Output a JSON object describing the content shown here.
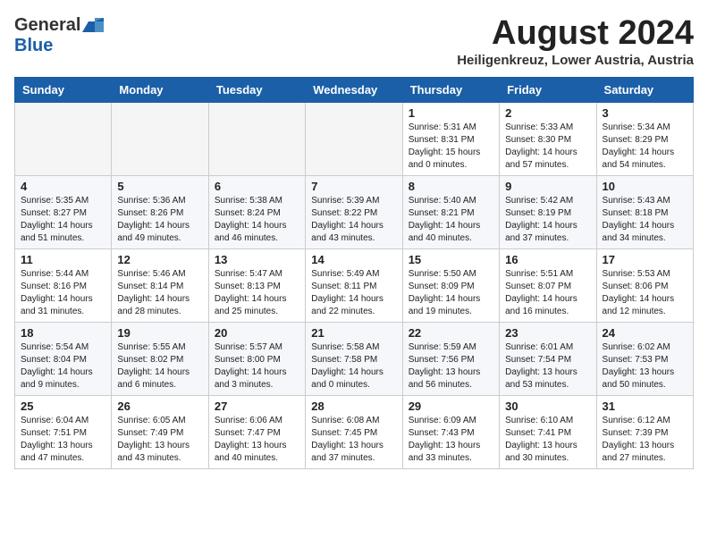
{
  "header": {
    "logo_general": "General",
    "logo_blue": "Blue",
    "month_title": "August 2024",
    "location": "Heiligenkreuz, Lower Austria, Austria"
  },
  "weekdays": [
    "Sunday",
    "Monday",
    "Tuesday",
    "Wednesday",
    "Thursday",
    "Friday",
    "Saturday"
  ],
  "weeks": [
    [
      {
        "day": "",
        "info": ""
      },
      {
        "day": "",
        "info": ""
      },
      {
        "day": "",
        "info": ""
      },
      {
        "day": "",
        "info": ""
      },
      {
        "day": "1",
        "info": "Sunrise: 5:31 AM\nSunset: 8:31 PM\nDaylight: 15 hours\nand 0 minutes."
      },
      {
        "day": "2",
        "info": "Sunrise: 5:33 AM\nSunset: 8:30 PM\nDaylight: 14 hours\nand 57 minutes."
      },
      {
        "day": "3",
        "info": "Sunrise: 5:34 AM\nSunset: 8:29 PM\nDaylight: 14 hours\nand 54 minutes."
      }
    ],
    [
      {
        "day": "4",
        "info": "Sunrise: 5:35 AM\nSunset: 8:27 PM\nDaylight: 14 hours\nand 51 minutes."
      },
      {
        "day": "5",
        "info": "Sunrise: 5:36 AM\nSunset: 8:26 PM\nDaylight: 14 hours\nand 49 minutes."
      },
      {
        "day": "6",
        "info": "Sunrise: 5:38 AM\nSunset: 8:24 PM\nDaylight: 14 hours\nand 46 minutes."
      },
      {
        "day": "7",
        "info": "Sunrise: 5:39 AM\nSunset: 8:22 PM\nDaylight: 14 hours\nand 43 minutes."
      },
      {
        "day": "8",
        "info": "Sunrise: 5:40 AM\nSunset: 8:21 PM\nDaylight: 14 hours\nand 40 minutes."
      },
      {
        "day": "9",
        "info": "Sunrise: 5:42 AM\nSunset: 8:19 PM\nDaylight: 14 hours\nand 37 minutes."
      },
      {
        "day": "10",
        "info": "Sunrise: 5:43 AM\nSunset: 8:18 PM\nDaylight: 14 hours\nand 34 minutes."
      }
    ],
    [
      {
        "day": "11",
        "info": "Sunrise: 5:44 AM\nSunset: 8:16 PM\nDaylight: 14 hours\nand 31 minutes."
      },
      {
        "day": "12",
        "info": "Sunrise: 5:46 AM\nSunset: 8:14 PM\nDaylight: 14 hours\nand 28 minutes."
      },
      {
        "day": "13",
        "info": "Sunrise: 5:47 AM\nSunset: 8:13 PM\nDaylight: 14 hours\nand 25 minutes."
      },
      {
        "day": "14",
        "info": "Sunrise: 5:49 AM\nSunset: 8:11 PM\nDaylight: 14 hours\nand 22 minutes."
      },
      {
        "day": "15",
        "info": "Sunrise: 5:50 AM\nSunset: 8:09 PM\nDaylight: 14 hours\nand 19 minutes."
      },
      {
        "day": "16",
        "info": "Sunrise: 5:51 AM\nSunset: 8:07 PM\nDaylight: 14 hours\nand 16 minutes."
      },
      {
        "day": "17",
        "info": "Sunrise: 5:53 AM\nSunset: 8:06 PM\nDaylight: 14 hours\nand 12 minutes."
      }
    ],
    [
      {
        "day": "18",
        "info": "Sunrise: 5:54 AM\nSunset: 8:04 PM\nDaylight: 14 hours\nand 9 minutes."
      },
      {
        "day": "19",
        "info": "Sunrise: 5:55 AM\nSunset: 8:02 PM\nDaylight: 14 hours\nand 6 minutes."
      },
      {
        "day": "20",
        "info": "Sunrise: 5:57 AM\nSunset: 8:00 PM\nDaylight: 14 hours\nand 3 minutes."
      },
      {
        "day": "21",
        "info": "Sunrise: 5:58 AM\nSunset: 7:58 PM\nDaylight: 14 hours\nand 0 minutes."
      },
      {
        "day": "22",
        "info": "Sunrise: 5:59 AM\nSunset: 7:56 PM\nDaylight: 13 hours\nand 56 minutes."
      },
      {
        "day": "23",
        "info": "Sunrise: 6:01 AM\nSunset: 7:54 PM\nDaylight: 13 hours\nand 53 minutes."
      },
      {
        "day": "24",
        "info": "Sunrise: 6:02 AM\nSunset: 7:53 PM\nDaylight: 13 hours\nand 50 minutes."
      }
    ],
    [
      {
        "day": "25",
        "info": "Sunrise: 6:04 AM\nSunset: 7:51 PM\nDaylight: 13 hours\nand 47 minutes."
      },
      {
        "day": "26",
        "info": "Sunrise: 6:05 AM\nSunset: 7:49 PM\nDaylight: 13 hours\nand 43 minutes."
      },
      {
        "day": "27",
        "info": "Sunrise: 6:06 AM\nSunset: 7:47 PM\nDaylight: 13 hours\nand 40 minutes."
      },
      {
        "day": "28",
        "info": "Sunrise: 6:08 AM\nSunset: 7:45 PM\nDaylight: 13 hours\nand 37 minutes."
      },
      {
        "day": "29",
        "info": "Sunrise: 6:09 AM\nSunset: 7:43 PM\nDaylight: 13 hours\nand 33 minutes."
      },
      {
        "day": "30",
        "info": "Sunrise: 6:10 AM\nSunset: 7:41 PM\nDaylight: 13 hours\nand 30 minutes."
      },
      {
        "day": "31",
        "info": "Sunrise: 6:12 AM\nSunset: 7:39 PM\nDaylight: 13 hours\nand 27 minutes."
      }
    ]
  ]
}
